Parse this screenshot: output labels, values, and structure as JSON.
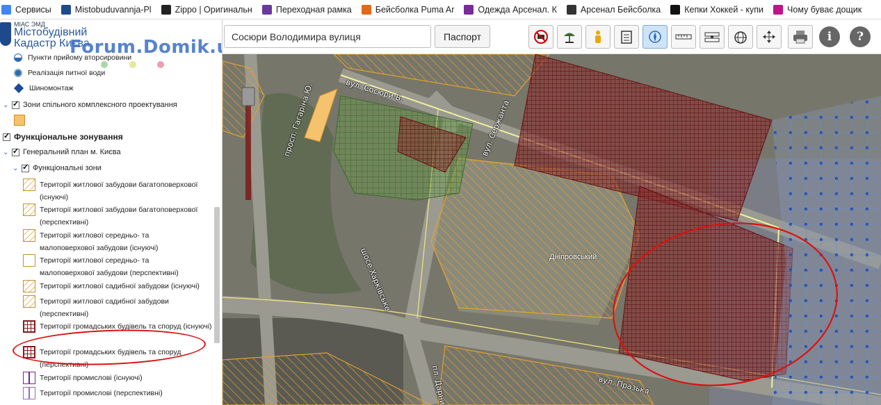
{
  "bookmarks": [
    {
      "label": "Сервисы",
      "icon": "apps-grid-icon",
      "color": "#4285f4"
    },
    {
      "label": "Mistobuduvannja-Pl",
      "icon": "kyiv-crest-icon",
      "color": "#1e4a8d"
    },
    {
      "label": "Zippo | Оригинальн",
      "icon": "zippo-logo-icon",
      "color": "#222222"
    },
    {
      "label": "Переходная рамка",
      "icon": "purple-square-icon",
      "color": "#6a3a9a"
    },
    {
      "label": "Бейсболка Puma Ar",
      "icon": "puma-paw-icon",
      "color": "#e06a1a"
    },
    {
      "label": "Одежда Арсенал. К",
      "icon": "purple-game-icon",
      "color": "#7a2a9a"
    },
    {
      "label": "Арсенал Бейсболка",
      "icon": "soccer-ball-icon",
      "color": "#333333"
    },
    {
      "label": "Кепки Хоккей - купи",
      "icon": "f-logo-icon",
      "color": "#111111"
    },
    {
      "label": "Чому буває дощик",
      "icon": "play-circle-icon",
      "color": "#c0148a"
    }
  ],
  "logo": {
    "small": "МІАС ЭМД",
    "line1": "Містобудівний",
    "line2": "Кадастр Києва"
  },
  "watermark": "Forum.Domik.ua",
  "search": {
    "value": "Сосюри Володимира вулиця",
    "button": "Паспорт"
  },
  "toolbar": {
    "tools": [
      "no-entry-icon",
      "beach-umbrella-icon",
      "person-icon",
      "clipboard-icon",
      "compass-icon",
      "ruler-icon",
      "measure-icon",
      "globe-pin-icon",
      "move-arrows-icon",
      "printer-icon",
      "info-icon",
      "help-icon"
    ],
    "info_label": "i",
    "help_label": "?"
  },
  "layers": {
    "top_items": [
      {
        "label": "Пункти прийому вторсировини"
      },
      {
        "label": "Реалізація питної води"
      },
      {
        "label": "Шиномонтаж"
      }
    ],
    "zones_group": "Зони спільного комплексного проектування",
    "functional_zoning": "Функціональне зонування",
    "general_plan": "Генеральний план м. Києва",
    "functional_zones": "Функціональні зони",
    "legend": [
      {
        "label": "Території житлової забудови багатоповерхової (існуючі)"
      },
      {
        "label": "Території житлової забудови багатоповерхової (перспективні)"
      },
      {
        "label": "Території житлової середньо- та малоповерхової забудови (існуючі)"
      },
      {
        "label": "Території житлової середньо- та малоповерхової забудови (перспективні)"
      },
      {
        "label": "Території житлової садибної забудови (існуючі)"
      },
      {
        "label": "Території житлової садибної забудови (перспективні)"
      },
      {
        "label": "Території громадських будівель та споруд (існуючі)"
      },
      {
        "label": "Території громадських будівель та споруд (перспективні)"
      },
      {
        "label": "Території промислові (існуючі)"
      },
      {
        "label": "Території промислові (перспективні)"
      }
    ]
  },
  "map": {
    "streets": {
      "sosiura": "вул. Сосюри В.",
      "serzhanta": "вул. Сержанта",
      "gagarina": "просп. Гагаріна Ю.",
      "kharkivske": "шосе Харківське",
      "darnytsia": "пл. Дарни",
      "prazka": "вул. Празька"
    },
    "district": "Дніпровський"
  },
  "colors": {
    "accent": "#2a6ab8",
    "public_zone": "#8a1a1a",
    "residential_zone": "#e0a030",
    "annotation": "#dd1111"
  }
}
